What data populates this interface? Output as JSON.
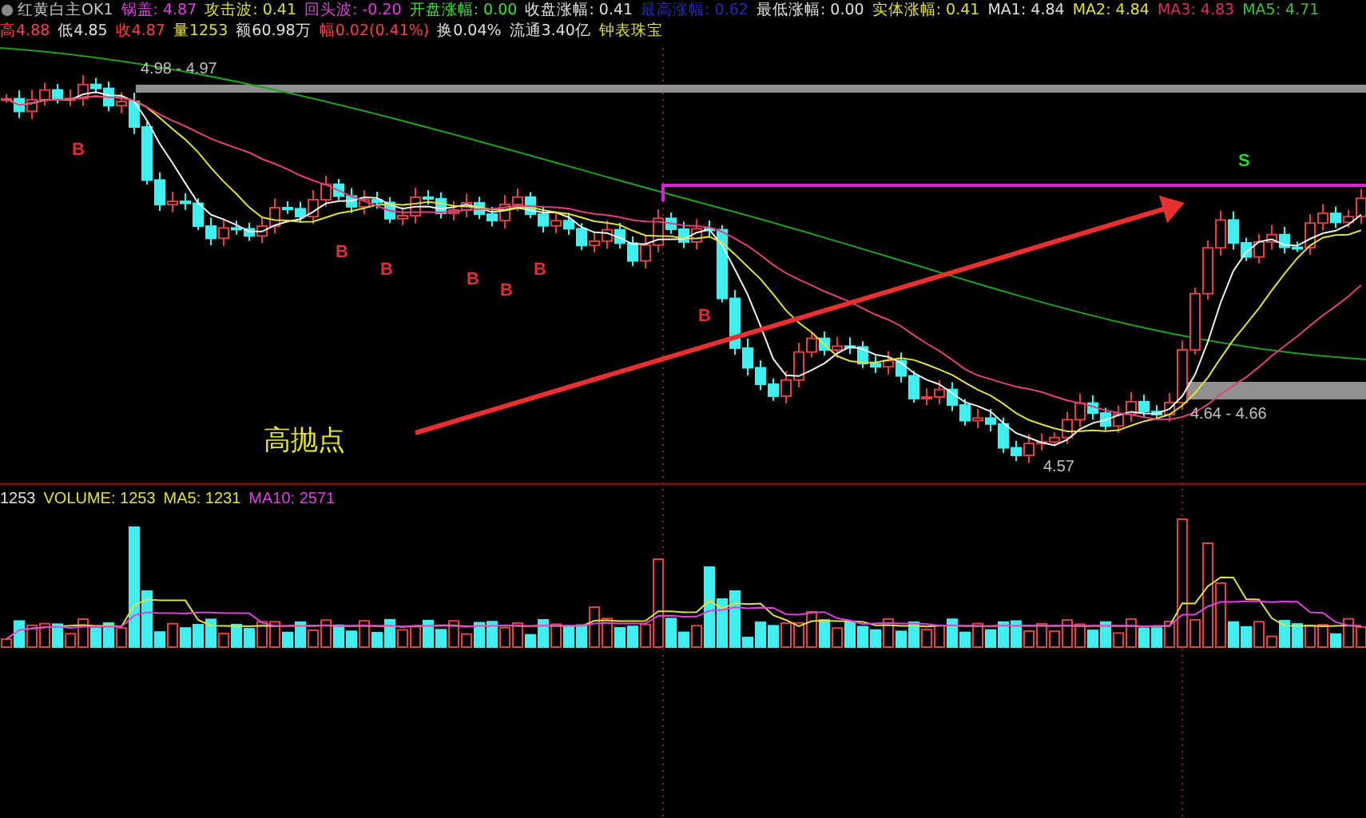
{
  "header": {
    "row1": [
      {
        "kind": "title",
        "text": "红黄白主OK1",
        "color": "#c8c8c8"
      },
      {
        "kind": "value",
        "text": "锅盖: 4.87",
        "color": "#e040e0"
      },
      {
        "kind": "value",
        "text": "攻击波: 0.41",
        "color": "#e0e040"
      },
      {
        "kind": "value",
        "text": "回头波: -0.20",
        "color": "#e040e0"
      },
      {
        "kind": "value",
        "text": "开盘涨幅: 0.00",
        "color": "#40e040"
      },
      {
        "kind": "value",
        "text": "收盘涨幅: 0.41",
        "color": "#e0e0e0"
      },
      {
        "kind": "value",
        "text": "最高涨幅: 0.62",
        "color": "#2a2ab8"
      },
      {
        "kind": "value",
        "text": "最低涨幅: 0.00",
        "color": "#e0e0e0"
      },
      {
        "kind": "value",
        "text": "实体涨幅: 0.41",
        "color": "#e0e040"
      },
      {
        "kind": "value",
        "text": "MA1: 4.84",
        "color": "#e0e0e0"
      },
      {
        "kind": "value",
        "text": "MA2: 4.84",
        "color": "#e0e040"
      },
      {
        "kind": "value",
        "text": "MA3: 4.83",
        "color": "#e03060"
      },
      {
        "kind": "value",
        "text": "MA5: 4.71",
        "color": "#40c040"
      }
    ],
    "row2": [
      {
        "text": "高4.88",
        "color": "#ff4040"
      },
      {
        "text": "低4.85",
        "color": "#e0e0e0"
      },
      {
        "text": "收4.87",
        "color": "#ff4040"
      },
      {
        "text": "量1253",
        "color": "#e0e040"
      },
      {
        "text": "额60.98万",
        "color": "#e0e0e0"
      },
      {
        "text": "幅0.02(0.41%)",
        "color": "#ff4040"
      },
      {
        "text": "换0.04%",
        "color": "#e0e0e0"
      },
      {
        "text": "流通3.40亿",
        "color": "#e0e0e0"
      },
      {
        "text": "钟表珠宝",
        "color": "#e0e040"
      }
    ]
  },
  "price_chart": {
    "band_labels": [
      "4.98 - 4.97",
      "4.64 - 4.66"
    ],
    "low_label": "4.57",
    "annotation": "高抛点",
    "markers": [
      {
        "text": "B",
        "kind": "buy"
      },
      {
        "text": "B",
        "kind": "buy"
      },
      {
        "text": "B",
        "kind": "buy"
      },
      {
        "text": "B",
        "kind": "buy"
      },
      {
        "text": "B",
        "kind": "buy"
      },
      {
        "text": "B",
        "kind": "buy"
      },
      {
        "text": "B",
        "kind": "buy"
      },
      {
        "text": "S",
        "kind": "sell"
      }
    ]
  },
  "volume_chart": {
    "legend": [
      {
        "text": "1253",
        "color": "#e0e0e0"
      },
      {
        "text": "VOLUME: 1253",
        "color": "#e0e040"
      },
      {
        "text": "MA5: 1231",
        "color": "#e0e040"
      },
      {
        "text": "MA10: 2571",
        "color": "#e040e0"
      }
    ]
  }
}
